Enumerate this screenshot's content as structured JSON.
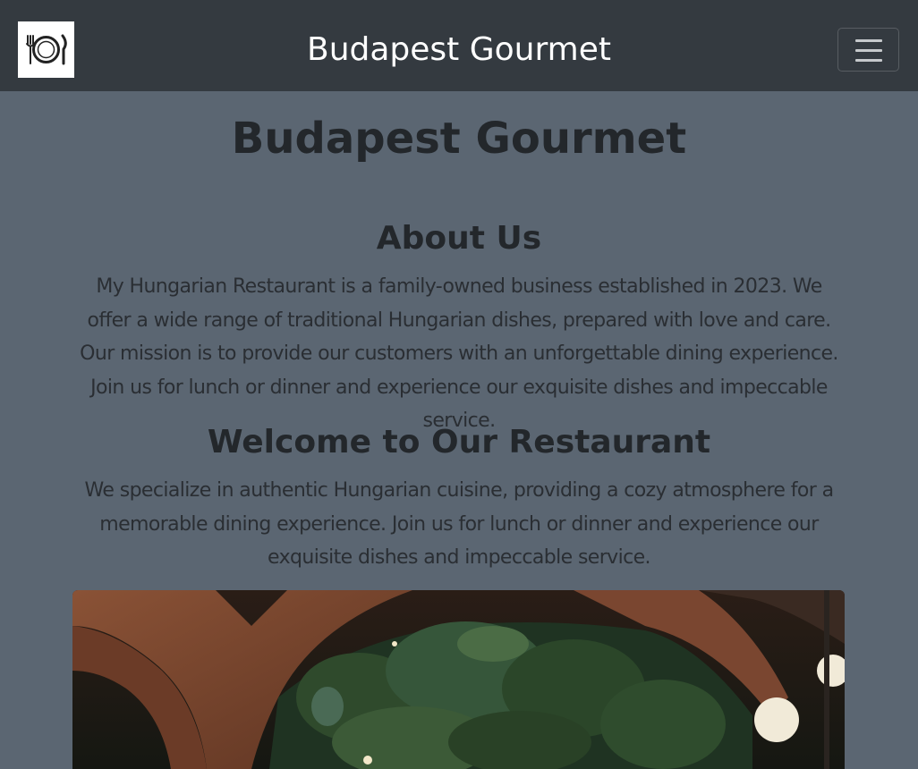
{
  "navbar": {
    "brand": "Budapest Gourmet",
    "logo_icon": "plate-fork-knife-icon",
    "toggler_icon": "hamburger-menu-icon"
  },
  "main": {
    "title": "Budapest Gourmet",
    "about": {
      "heading": "About Us",
      "text": "My Hungarian Restaurant is a family-owned business established in 2023. We offer a wide range of traditional Hungarian dishes, prepared with love and care. Our mission is to provide our customers with an unforgettable dining experience. Join us for lunch or dinner and experience our exquisite dishes and impeccable service."
    },
    "welcome": {
      "heading": "Welcome to Our Restaurant",
      "text": "We specialize in authentic Hungarian cuisine, providing a cozy atmosphere for a memorable dining experience. Join us for lunch or dinner and experience our exquisite dishes and impeccable service."
    }
  },
  "colors": {
    "navbar_bg": "#343a40",
    "page_bg": "#5b6672",
    "heading_text": "#23272b",
    "brand_text": "#ffffff"
  }
}
